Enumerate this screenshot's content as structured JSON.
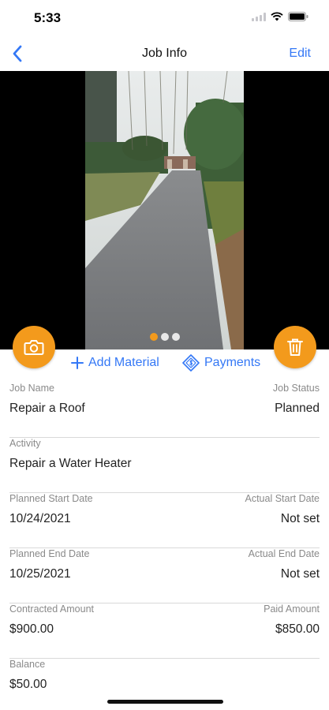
{
  "status": {
    "time": "5:33"
  },
  "nav": {
    "title": "Job Info",
    "edit_label": "Edit"
  },
  "photos": {
    "count": 3,
    "active_index": 0
  },
  "actions": {
    "add_material": "Add Material",
    "payments": "Payments"
  },
  "colors": {
    "accent": "#f39a1c",
    "link": "#3478f6"
  },
  "icons": {
    "back": "chevron-left-icon",
    "camera": "camera-icon",
    "trash": "trash-icon",
    "plus": "plus-icon",
    "payments": "money-bill-icon"
  },
  "fields": {
    "job_name_label": "Job Name",
    "job_name": "Repair a Roof",
    "job_status_label": "Job Status",
    "job_status": "Planned",
    "activity_label": "Activity",
    "activity": "Repair a Water Heater",
    "planned_start_label": "Planned Start Date",
    "planned_start": "10/24/2021",
    "actual_start_label": "Actual Start Date",
    "actual_start": "Not set",
    "planned_end_label": "Planned End Date",
    "planned_end": "10/25/2021",
    "actual_end_label": "Actual End Date",
    "actual_end": "Not set",
    "contracted_label": "Contracted Amount",
    "contracted": "$900.00",
    "paid_label": "Paid Amount",
    "paid": "$850.00",
    "balance_label": "Balance",
    "balance": "$50.00"
  }
}
